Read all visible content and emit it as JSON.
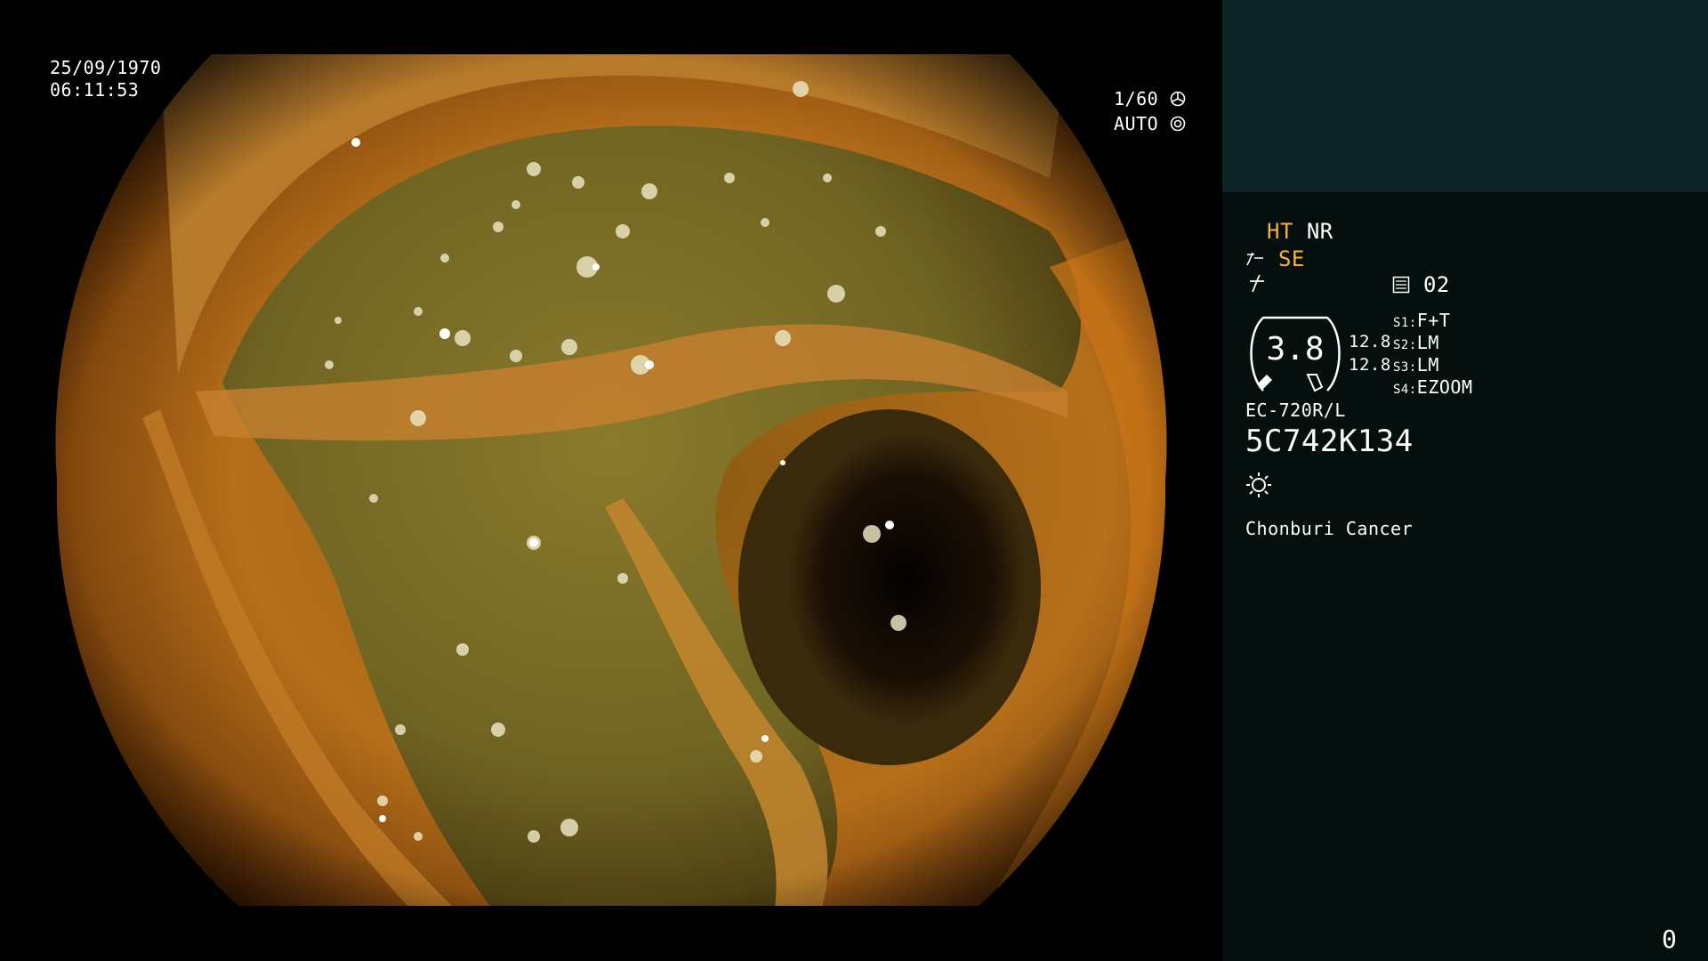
{
  "viewer": {
    "date": "25/09/1970",
    "time": "06:11:53",
    "shutter": "1/60",
    "iris": "AUTO",
    "image_icon": "endoscopic-colon-view"
  },
  "panel": {
    "mode_ht": "HT",
    "mode_nr": "NR",
    "mode_se": "SE",
    "memory_slot": "02",
    "zoom_value": "3.8",
    "zoom_left_top": "12.8",
    "zoom_left_bottom": "12.8",
    "switches": [
      {
        "key": "S1",
        "value": "F+T"
      },
      {
        "key": "S2",
        "value": "LM"
      },
      {
        "key": "S3",
        "value": "LM"
      },
      {
        "key": "S4",
        "value": "EZOOM"
      }
    ],
    "scope_model": "EC-720R/L",
    "scope_serial": "5C742K134",
    "institution": "Chonburi Cancer",
    "counter": "0"
  },
  "colors": {
    "panel_bg": "#040f0e",
    "panel_top_bg": "#0c2426",
    "accent": "#f7b23a"
  }
}
